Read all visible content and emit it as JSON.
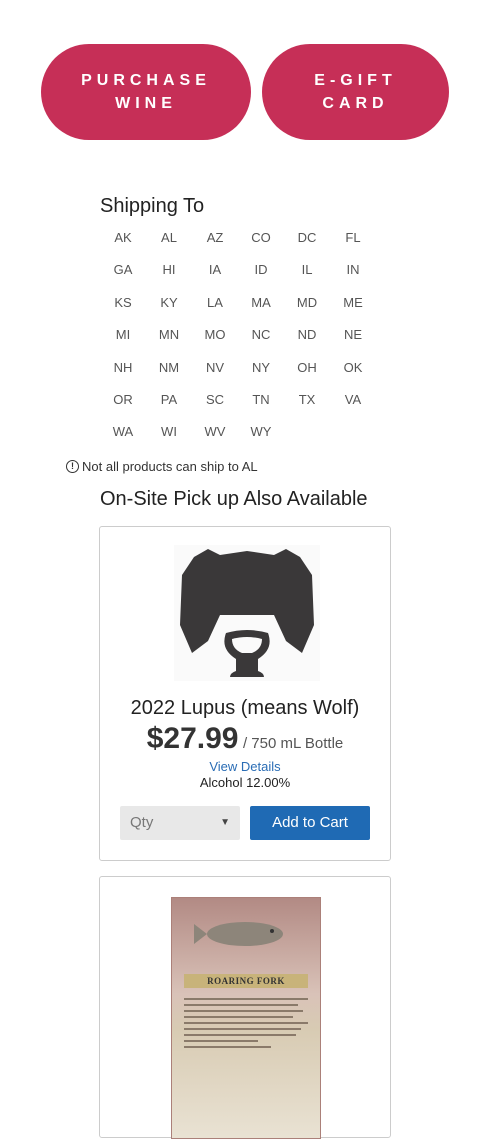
{
  "buttons": {
    "purchase_wine": "PURCHASE\nWINE",
    "egift_card": "E-GIFT\nCARD"
  },
  "shipping": {
    "title": "Shipping To",
    "states": [
      "AK",
      "AL",
      "AZ",
      "CO",
      "DC",
      "FL",
      "GA",
      "HI",
      "IA",
      "ID",
      "IL",
      "IN",
      "KS",
      "KY",
      "LA",
      "MA",
      "MD",
      "ME",
      "MI",
      "MN",
      "MO",
      "NC",
      "ND",
      "NE",
      "NH",
      "NM",
      "NV",
      "NY",
      "OH",
      "OK",
      "OR",
      "PA",
      "SC",
      "TN",
      "TX",
      "VA",
      "WA",
      "WI",
      "WV",
      "WY"
    ],
    "notice": "Not all products can ship to AL"
  },
  "pickup": {
    "title": "On-Site Pick up Also Available"
  },
  "products": [
    {
      "name": "2022 Lupus (means Wolf)",
      "price": "$27.99",
      "unit": "/ 750 mL Bottle",
      "view_details": "View Details",
      "alcohol": "Alcohol 12.00%",
      "qty_placeholder": "Qty",
      "add_to_cart": "Add to Cart"
    },
    {
      "label_text": "ROARING FORK"
    }
  ],
  "colors": {
    "accent": "#c62f57",
    "link": "#2a6db5",
    "cart_button": "#1f6ab4"
  }
}
